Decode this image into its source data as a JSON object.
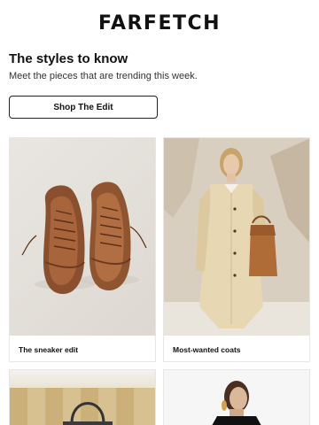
{
  "header": {
    "logo": "FARFETCH"
  },
  "intro": {
    "title": "The styles to know",
    "subtitle": "Meet the pieces that are trending this week.",
    "cta_label": "Shop The Edit"
  },
  "cards": [
    {
      "caption": "The sneaker edit",
      "image": "bronze-sneakers-photo"
    },
    {
      "caption": "Most-wanted coats",
      "image": "woman-cream-coat-photo"
    },
    {
      "caption": "",
      "image": "handbag-photo"
    },
    {
      "caption": "",
      "image": "model-portrait-photo"
    }
  ]
}
